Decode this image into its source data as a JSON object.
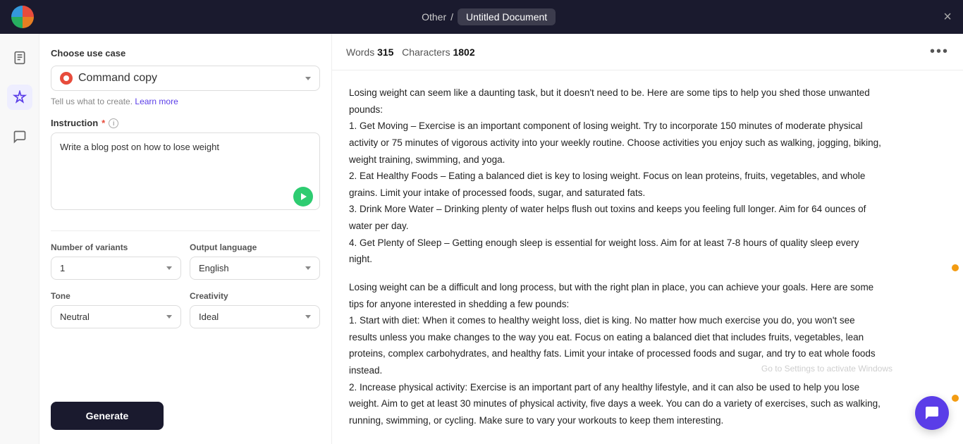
{
  "topbar": {
    "breadcrumb_prefix": "Other",
    "breadcrumb_separator": "/",
    "doc_title": "Untitled Document",
    "close_label": "×"
  },
  "left_panel": {
    "choose_use_case_label": "Choose use case",
    "use_case_value": "Command copy",
    "hint_prefix": "Tell us what to create.",
    "hint_link": "Learn more",
    "instruction_label": "Instruction",
    "instruction_value": "Write a blog post on how to lose weight",
    "number_of_variants_label": "Number of variants",
    "number_of_variants_value": "1",
    "output_language_label": "Output language",
    "output_language_value": "English",
    "tone_label": "Tone",
    "tone_value": "Neutral",
    "creativity_label": "Creativity",
    "creativity_value": "Ideal",
    "generate_button": "Generate"
  },
  "content_area": {
    "words_label": "Words",
    "words_count": "315",
    "characters_label": "Characters",
    "characters_count": "1802",
    "more_icon": "•••",
    "paragraphs": [
      "Losing weight can seem like a daunting task, but it doesn't need to be. Here are some tips to help you shed those unwanted pounds:\n1. Get Moving – Exercise is an important component of losing weight. Try to incorporate 150 minutes of moderate physical activity or 75 minutes of vigorous activity into your weekly routine. Choose activities you enjoy such as walking, jogging, biking, weight training, swimming, and yoga.\n2. Eat Healthy Foods – Eating a balanced diet is key to losing weight. Focus on lean proteins, fruits, vegetables, and whole grains. Limit your intake of processed foods, sugar, and saturated fats.\n3. Drink More Water – Drinking plenty of water helps flush out toxins and keeps you feeling full longer. Aim for 64 ounces of water per day.\n4. Get Plenty of Sleep – Getting enough sleep is essential for weight loss. Aim for at least 7-8 hours of quality sleep every night.",
      "Losing weight can be a difficult and long process, but with the right plan in place, you can achieve your goals. Here are some tips for anyone interested in shedding a few pounds:\n1. Start with diet: When it comes to healthy weight loss, diet is king. No matter how much exercise you do, you won't see results unless you make changes to the way you eat. Focus on eating a balanced diet that includes fruits, vegetables, lean proteins, complex carbohydrates, and healthy fats. Limit your intake of processed foods and sugar, and try to eat whole foods instead.\n2. Increase physical activity: Exercise is an important part of any healthy lifestyle, and it can also be used to help you lose weight. Aim to get at least 30 minutes of physical activity, five days a week. You can do a variety of exercises, such as walking, running, swimming, or cycling. Make sure to vary your workouts to keep them interesting."
    ]
  },
  "sidebar_icons": [
    {
      "name": "document-icon",
      "symbol": "⊞",
      "active": false
    },
    {
      "name": "magic-icon",
      "symbol": "✦",
      "active": true
    },
    {
      "name": "chat-icon",
      "symbol": "💬",
      "active": false
    }
  ],
  "windows_watermark": "Go to Settings to activate Windows"
}
